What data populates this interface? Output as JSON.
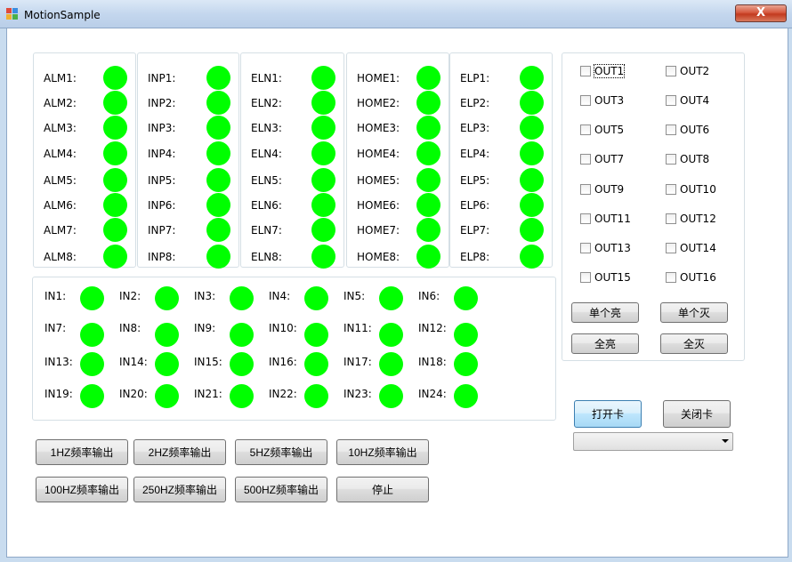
{
  "window": {
    "title": "MotionSample",
    "close_glyph": "X"
  },
  "status_groups": [
    {
      "id": "alm",
      "labels": [
        "ALM1:",
        "ALM2:",
        "ALM3:",
        "ALM4:",
        "ALM5:",
        "ALM6:",
        "ALM7:",
        "ALM8:"
      ]
    },
    {
      "id": "inp",
      "labels": [
        "INP1:",
        "INP2:",
        "INP3:",
        "INP4:",
        "INP5:",
        "INP6:",
        "INP7:",
        "INP8:"
      ]
    },
    {
      "id": "eln",
      "labels": [
        "ELN1:",
        "ELN2:",
        "ELN3:",
        "ELN4:",
        "ELN5:",
        "ELN6:",
        "ELN7:",
        "ELN8:"
      ]
    },
    {
      "id": "home",
      "labels": [
        "HOME1:",
        "HOME2:",
        "HOME3:",
        "HOME4:",
        "HOME5:",
        "HOME6:",
        "HOME7:",
        "HOME8:"
      ]
    },
    {
      "id": "elp",
      "labels": [
        "ELP1:",
        "ELP2:",
        "ELP3:",
        "ELP4:",
        "ELP5:",
        "ELP6:",
        "ELP7:",
        "ELP8:"
      ]
    }
  ],
  "inputs": [
    "IN1:",
    "IN2:",
    "IN3:",
    "IN4:",
    "IN5:",
    "IN6:",
    "IN7:",
    "IN8:",
    "IN9:",
    "IN10:",
    "IN11:",
    "IN12:",
    "IN13:",
    "IN14:",
    "IN15:",
    "IN16:",
    "IN17:",
    "IN18:",
    "IN19:",
    "IN20:",
    "IN21:",
    "IN22:",
    "IN23:",
    "IN24:"
  ],
  "outputs": [
    "OUT1",
    "OUT2",
    "OUT3",
    "OUT4",
    "OUT5",
    "OUT6",
    "OUT7",
    "OUT8",
    "OUT9",
    "OUT10",
    "OUT11",
    "OUT12",
    "OUT13",
    "OUT14",
    "OUT15",
    "OUT16"
  ],
  "output_buttons": {
    "single_on": "单个亮",
    "single_off": "单个灭",
    "all_on": "全亮",
    "all_off": "全灭"
  },
  "card_buttons": {
    "open": "打开卡",
    "close": "关闭卡",
    "card_select_value": ""
  },
  "freq_buttons": [
    "1HZ频率输出",
    "2HZ频率输出",
    "5HZ频率输出",
    "10HZ频率输出",
    "100HZ频率输出",
    "250HZ频率输出",
    "500HZ频率输出",
    "停止"
  ],
  "colors": {
    "led_on": "#00ff00",
    "client_bg": "#ffffff",
    "frame": "#c9dcef"
  }
}
